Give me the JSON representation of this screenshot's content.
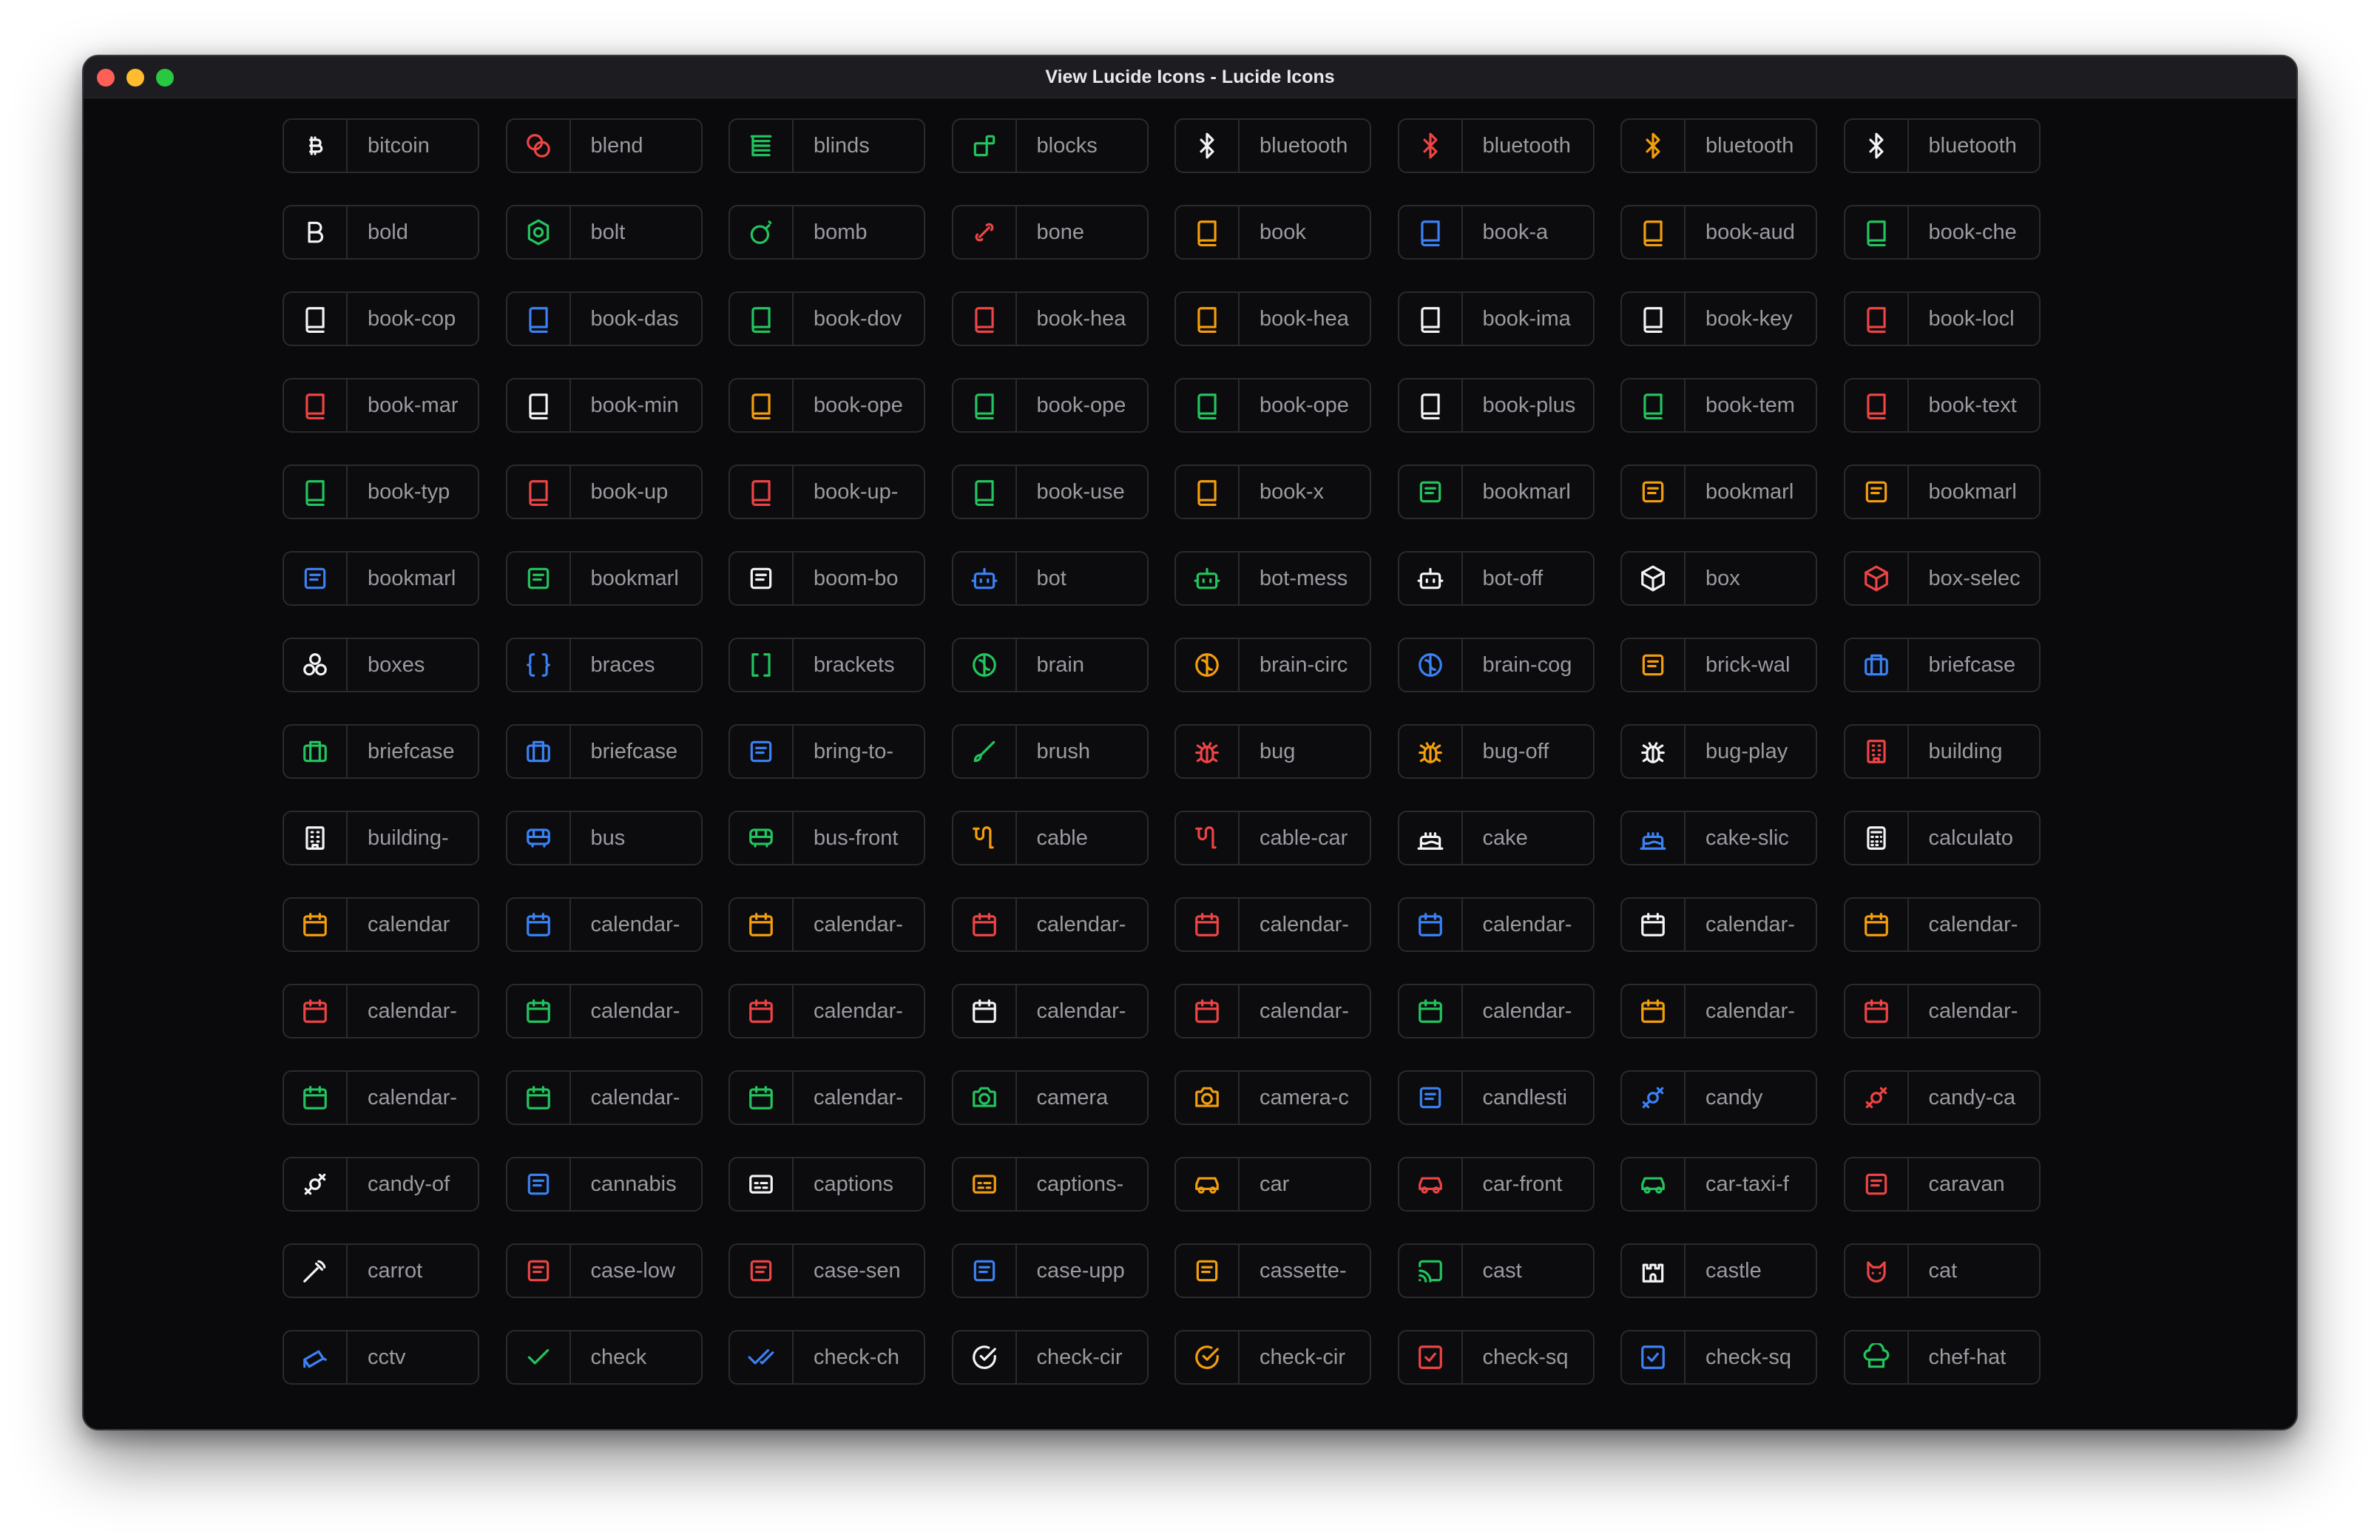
{
  "window": {
    "title": "View Lucide Icons - Lucide Icons"
  },
  "colors": {
    "white": "#f4f4f5",
    "red": "#ef4444",
    "orange": "#f59e0b",
    "green": "#22c55e",
    "blue": "#3b82f6"
  },
  "tiles": [
    {
      "label": "bitcoin",
      "color": "white",
      "icon": "bitcoin-icon"
    },
    {
      "label": "blend",
      "color": "red",
      "icon": "blend-icon"
    },
    {
      "label": "blinds",
      "color": "green",
      "icon": "blinds-icon"
    },
    {
      "label": "blocks",
      "color": "green",
      "icon": "blocks-icon"
    },
    {
      "label": "bluetooth",
      "color": "white",
      "icon": "bluetooth-icon"
    },
    {
      "label": "bluetooth",
      "color": "red",
      "icon": "bluetooth-connected-icon"
    },
    {
      "label": "bluetooth",
      "color": "orange",
      "icon": "bluetooth-off-icon"
    },
    {
      "label": "bluetooth",
      "color": "white",
      "icon": "bluetooth-searching-icon"
    },
    {
      "label": "bold",
      "color": "white",
      "icon": "bold-icon"
    },
    {
      "label": "bolt",
      "color": "green",
      "icon": "bolt-icon"
    },
    {
      "label": "bomb",
      "color": "green",
      "icon": "bomb-icon"
    },
    {
      "label": "bone",
      "color": "red",
      "icon": "bone-icon"
    },
    {
      "label": "book",
      "color": "orange",
      "icon": "book-icon"
    },
    {
      "label": "book-a",
      "color": "blue",
      "icon": "book-a-icon"
    },
    {
      "label": "book-aud",
      "color": "orange",
      "icon": "book-audio-icon"
    },
    {
      "label": "book-che",
      "color": "green",
      "icon": "book-check-icon"
    },
    {
      "label": "book-cop",
      "color": "white",
      "icon": "book-copy-icon"
    },
    {
      "label": "book-das",
      "color": "blue",
      "icon": "book-dashed-icon"
    },
    {
      "label": "book-dov",
      "color": "green",
      "icon": "book-down-icon"
    },
    {
      "label": "book-hea",
      "color": "red",
      "icon": "book-headphones-icon"
    },
    {
      "label": "book-hea",
      "color": "orange",
      "icon": "book-heart-icon"
    },
    {
      "label": "book-ima",
      "color": "white",
      "icon": "book-image-icon"
    },
    {
      "label": "book-key",
      "color": "white",
      "icon": "book-key-icon"
    },
    {
      "label": "book-locl",
      "color": "red",
      "icon": "book-lock-icon"
    },
    {
      "label": "book-mar",
      "color": "red",
      "icon": "book-marked-icon"
    },
    {
      "label": "book-min",
      "color": "white",
      "icon": "book-minus-icon"
    },
    {
      "label": "book-ope",
      "color": "orange",
      "icon": "book-open-icon"
    },
    {
      "label": "book-ope",
      "color": "green",
      "icon": "book-open-check-icon"
    },
    {
      "label": "book-ope",
      "color": "green",
      "icon": "book-open-text-icon"
    },
    {
      "label": "book-plus",
      "color": "white",
      "icon": "book-plus-icon"
    },
    {
      "label": "book-tem",
      "color": "green",
      "icon": "book-template-icon"
    },
    {
      "label": "book-text",
      "color": "red",
      "icon": "book-text-icon"
    },
    {
      "label": "book-typ",
      "color": "green",
      "icon": "book-type-icon"
    },
    {
      "label": "book-up",
      "color": "red",
      "icon": "book-up-icon"
    },
    {
      "label": "book-up-",
      "color": "red",
      "icon": "book-up-2-icon"
    },
    {
      "label": "book-use",
      "color": "green",
      "icon": "book-user-icon"
    },
    {
      "label": "book-x",
      "color": "orange",
      "icon": "book-x-icon"
    },
    {
      "label": "bookmarl",
      "color": "green",
      "icon": "bookmark-icon"
    },
    {
      "label": "bookmarl",
      "color": "orange",
      "icon": "bookmark-check-icon"
    },
    {
      "label": "bookmarl",
      "color": "orange",
      "icon": "bookmark-minus-icon"
    },
    {
      "label": "bookmarl",
      "color": "blue",
      "icon": "bookmark-plus-icon"
    },
    {
      "label": "bookmarl",
      "color": "green",
      "icon": "bookmark-x-icon"
    },
    {
      "label": "boom-bo",
      "color": "white",
      "icon": "boom-box-icon"
    },
    {
      "label": "bot",
      "color": "blue",
      "icon": "bot-icon"
    },
    {
      "label": "bot-mess",
      "color": "green",
      "icon": "bot-message-square-icon"
    },
    {
      "label": "bot-off",
      "color": "white",
      "icon": "bot-off-icon"
    },
    {
      "label": "box",
      "color": "white",
      "icon": "box-icon"
    },
    {
      "label": "box-selec",
      "color": "red",
      "icon": "box-select-icon"
    },
    {
      "label": "boxes",
      "color": "white",
      "icon": "boxes-icon"
    },
    {
      "label": "braces",
      "color": "blue",
      "icon": "braces-icon"
    },
    {
      "label": "brackets",
      "color": "green",
      "icon": "brackets-icon"
    },
    {
      "label": "brain",
      "color": "green",
      "icon": "brain-icon"
    },
    {
      "label": "brain-circ",
      "color": "orange",
      "icon": "brain-circuit-icon"
    },
    {
      "label": "brain-cog",
      "color": "blue",
      "icon": "brain-cog-icon"
    },
    {
      "label": "brick-wal",
      "color": "orange",
      "icon": "brick-wall-icon"
    },
    {
      "label": "briefcase",
      "color": "blue",
      "icon": "briefcase-icon"
    },
    {
      "label": "briefcase",
      "color": "green",
      "icon": "briefcase-business-icon"
    },
    {
      "label": "briefcase",
      "color": "blue",
      "icon": "briefcase-medical-icon"
    },
    {
      "label": "bring-to-",
      "color": "blue",
      "icon": "bring-to-front-icon"
    },
    {
      "label": "brush",
      "color": "green",
      "icon": "brush-icon"
    },
    {
      "label": "bug",
      "color": "red",
      "icon": "bug-icon"
    },
    {
      "label": "bug-off",
      "color": "orange",
      "icon": "bug-off-icon"
    },
    {
      "label": "bug-play",
      "color": "white",
      "icon": "bug-play-icon"
    },
    {
      "label": "building",
      "color": "red",
      "icon": "building-icon"
    },
    {
      "label": "building-",
      "color": "white",
      "icon": "building-2-icon"
    },
    {
      "label": "bus",
      "color": "blue",
      "icon": "bus-icon"
    },
    {
      "label": "bus-front",
      "color": "green",
      "icon": "bus-front-icon"
    },
    {
      "label": "cable",
      "color": "orange",
      "icon": "cable-icon"
    },
    {
      "label": "cable-car",
      "color": "red",
      "icon": "cable-car-icon"
    },
    {
      "label": "cake",
      "color": "white",
      "icon": "cake-icon"
    },
    {
      "label": "cake-slic",
      "color": "blue",
      "icon": "cake-slice-icon"
    },
    {
      "label": "calculato",
      "color": "white",
      "icon": "calculator-icon"
    },
    {
      "label": "calendar",
      "color": "orange",
      "icon": "calendar-icon"
    },
    {
      "label": "calendar-",
      "color": "blue",
      "icon": "calendar-arrow-down-icon"
    },
    {
      "label": "calendar-",
      "color": "orange",
      "icon": "calendar-arrow-up-icon"
    },
    {
      "label": "calendar-",
      "color": "red",
      "icon": "calendar-check-icon"
    },
    {
      "label": "calendar-",
      "color": "red",
      "icon": "calendar-check-2-icon"
    },
    {
      "label": "calendar-",
      "color": "blue",
      "icon": "calendar-clock-icon"
    },
    {
      "label": "calendar-",
      "color": "white",
      "icon": "calendar-cog-icon"
    },
    {
      "label": "calendar-",
      "color": "orange",
      "icon": "calendar-days-icon"
    },
    {
      "label": "calendar-",
      "color": "red",
      "icon": "calendar-fold-icon"
    },
    {
      "label": "calendar-",
      "color": "green",
      "icon": "calendar-heart-icon"
    },
    {
      "label": "calendar-",
      "color": "red",
      "icon": "calendar-minus-icon"
    },
    {
      "label": "calendar-",
      "color": "white",
      "icon": "calendar-minus-2-icon"
    },
    {
      "label": "calendar-",
      "color": "red",
      "icon": "calendar-off-icon"
    },
    {
      "label": "calendar-",
      "color": "green",
      "icon": "calendar-plus-icon"
    },
    {
      "label": "calendar-",
      "color": "orange",
      "icon": "calendar-plus-2-icon"
    },
    {
      "label": "calendar-",
      "color": "red",
      "icon": "calendar-range-icon"
    },
    {
      "label": "calendar-",
      "color": "green",
      "icon": "calendar-search-icon"
    },
    {
      "label": "calendar-",
      "color": "green",
      "icon": "calendar-x-icon"
    },
    {
      "label": "calendar-",
      "color": "green",
      "icon": "calendar-x-2-icon"
    },
    {
      "label": "camera",
      "color": "green",
      "icon": "camera-icon"
    },
    {
      "label": "camera-c",
      "color": "orange",
      "icon": "camera-off-icon"
    },
    {
      "label": "candlesti",
      "color": "blue",
      "icon": "candlestick-chart-icon"
    },
    {
      "label": "candy",
      "color": "blue",
      "icon": "candy-icon"
    },
    {
      "label": "candy-ca",
      "color": "red",
      "icon": "candy-cane-icon"
    },
    {
      "label": "candy-of",
      "color": "white",
      "icon": "candy-off-icon"
    },
    {
      "label": "cannabis",
      "color": "blue",
      "icon": "cannabis-icon"
    },
    {
      "label": "captions",
      "color": "white",
      "icon": "captions-icon"
    },
    {
      "label": "captions-",
      "color": "orange",
      "icon": "captions-off-icon"
    },
    {
      "label": "car",
      "color": "orange",
      "icon": "car-icon"
    },
    {
      "label": "car-front",
      "color": "red",
      "icon": "car-front-icon"
    },
    {
      "label": "car-taxi-f",
      "color": "green",
      "icon": "car-taxi-front-icon"
    },
    {
      "label": "caravan",
      "color": "red",
      "icon": "caravan-icon"
    },
    {
      "label": "carrot",
      "color": "white",
      "icon": "carrot-icon"
    },
    {
      "label": "case-low",
      "color": "red",
      "icon": "case-lower-icon"
    },
    {
      "label": "case-sen",
      "color": "red",
      "icon": "case-sensitive-icon"
    },
    {
      "label": "case-upp",
      "color": "blue",
      "icon": "case-upper-icon"
    },
    {
      "label": "cassette-",
      "color": "orange",
      "icon": "cassette-tape-icon"
    },
    {
      "label": "cast",
      "color": "green",
      "icon": "cast-icon"
    },
    {
      "label": "castle",
      "color": "white",
      "icon": "castle-icon"
    },
    {
      "label": "cat",
      "color": "red",
      "icon": "cat-icon"
    },
    {
      "label": "cctv",
      "color": "blue",
      "icon": "cctv-icon"
    },
    {
      "label": "check",
      "color": "green",
      "icon": "check-icon"
    },
    {
      "label": "check-ch",
      "color": "blue",
      "icon": "check-check-icon"
    },
    {
      "label": "check-cir",
      "color": "white",
      "icon": "check-circle-icon"
    },
    {
      "label": "check-cir",
      "color": "orange",
      "icon": "check-circle-2-icon"
    },
    {
      "label": "check-sq",
      "color": "red",
      "icon": "check-square-icon"
    },
    {
      "label": "check-sq",
      "color": "blue",
      "icon": "check-square-2-icon"
    },
    {
      "label": "chef-hat",
      "color": "green",
      "icon": "chef-hat-icon"
    }
  ]
}
